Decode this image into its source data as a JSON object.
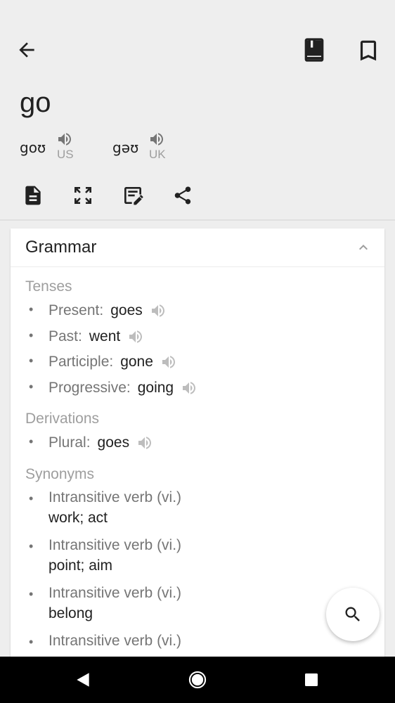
{
  "header": {
    "word": "go",
    "pronunciations": [
      {
        "ipa": "goʊ",
        "region": "US"
      },
      {
        "ipa": "gəʊ",
        "region": "UK"
      }
    ]
  },
  "icons": {
    "back": "arrow-back-icon",
    "wordbook": "wordbook-icon",
    "bookmark": "bookmark-icon",
    "actions": [
      "document-icon",
      "fullscreen-icon",
      "edit-note-icon",
      "share-icon"
    ],
    "fab": "search-icon"
  },
  "grammar": {
    "title": "Grammar",
    "tenses_label": "Tenses",
    "tenses": [
      {
        "label": "Present:",
        "value": "goes"
      },
      {
        "label": "Past:",
        "value": "went"
      },
      {
        "label": "Participle:",
        "value": "gone"
      },
      {
        "label": "Progressive:",
        "value": "going"
      }
    ],
    "derivations_label": "Derivations",
    "derivations": [
      {
        "label": "Plural:",
        "value": "goes"
      }
    ],
    "synonyms_label": "Synonyms",
    "synonyms": [
      {
        "pos": "Intransitive verb (vi.)",
        "words": "work; act"
      },
      {
        "pos": "Intransitive verb (vi.)",
        "words": "point; aim"
      },
      {
        "pos": "Intransitive verb (vi.)",
        "words": "belong"
      },
      {
        "pos": "Intransitive verb (vi.)",
        "words": ""
      }
    ]
  },
  "colors": {
    "background": "#eeeeee",
    "card": "#ffffff",
    "secondary_text": "#757575",
    "label_gray": "#9e9e9e",
    "navbar": "#000000"
  }
}
